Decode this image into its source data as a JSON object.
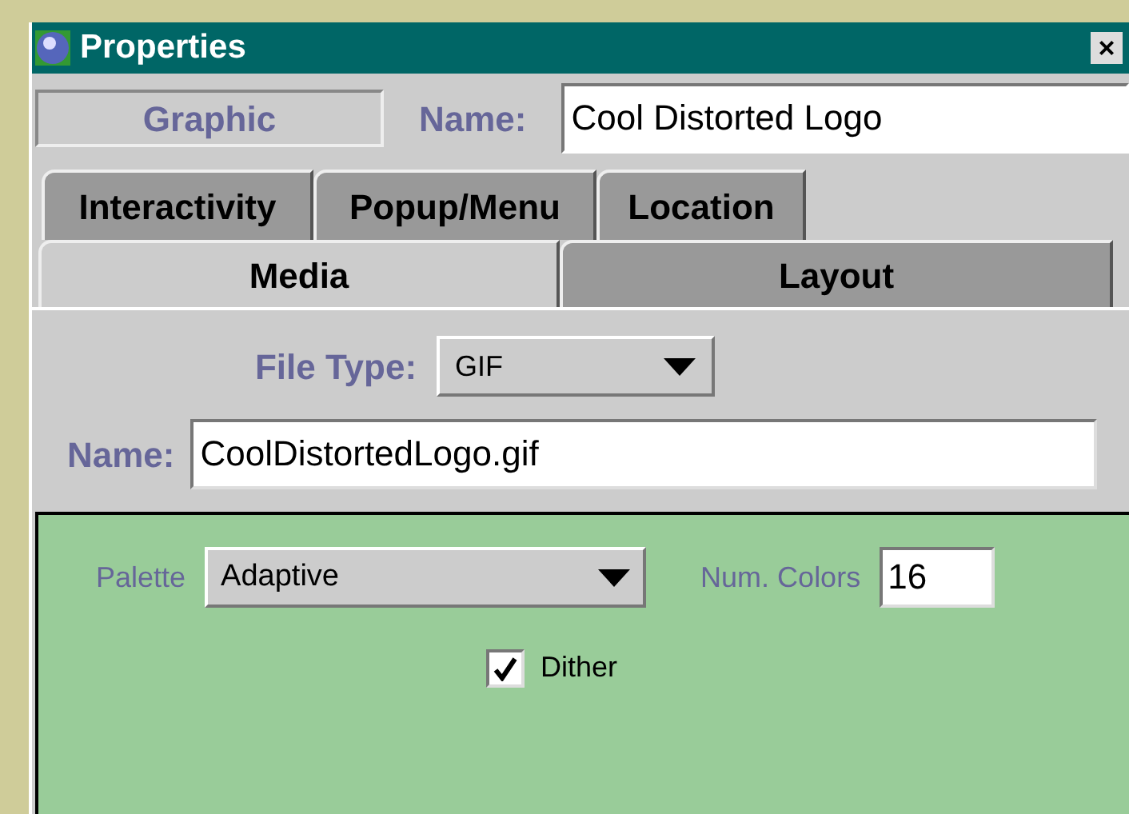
{
  "window": {
    "title": "Properties",
    "close": "×"
  },
  "header": {
    "object_type": "Graphic",
    "name_label": "Name:",
    "name_value": "Cool Distorted Logo"
  },
  "tab_rows": [
    [
      {
        "label": "Interactivity",
        "selected": false
      },
      {
        "label": "Popup/Menu",
        "selected": false
      },
      {
        "label": "Location",
        "selected": false
      }
    ],
    [
      {
        "label": "Media",
        "selected": true
      },
      {
        "label": "Layout",
        "selected": false
      }
    ]
  ],
  "media": {
    "file_type_label": "File Type:",
    "file_type_value": "GIF",
    "name_label": "Name:",
    "name_value": "CoolDistortedLogo.gif",
    "palette_label": "Palette",
    "palette_value": "Adaptive",
    "num_colors_label": "Num. Colors",
    "num_colors_value": "16",
    "dither": {
      "label": "Dither",
      "checked": true
    }
  }
}
